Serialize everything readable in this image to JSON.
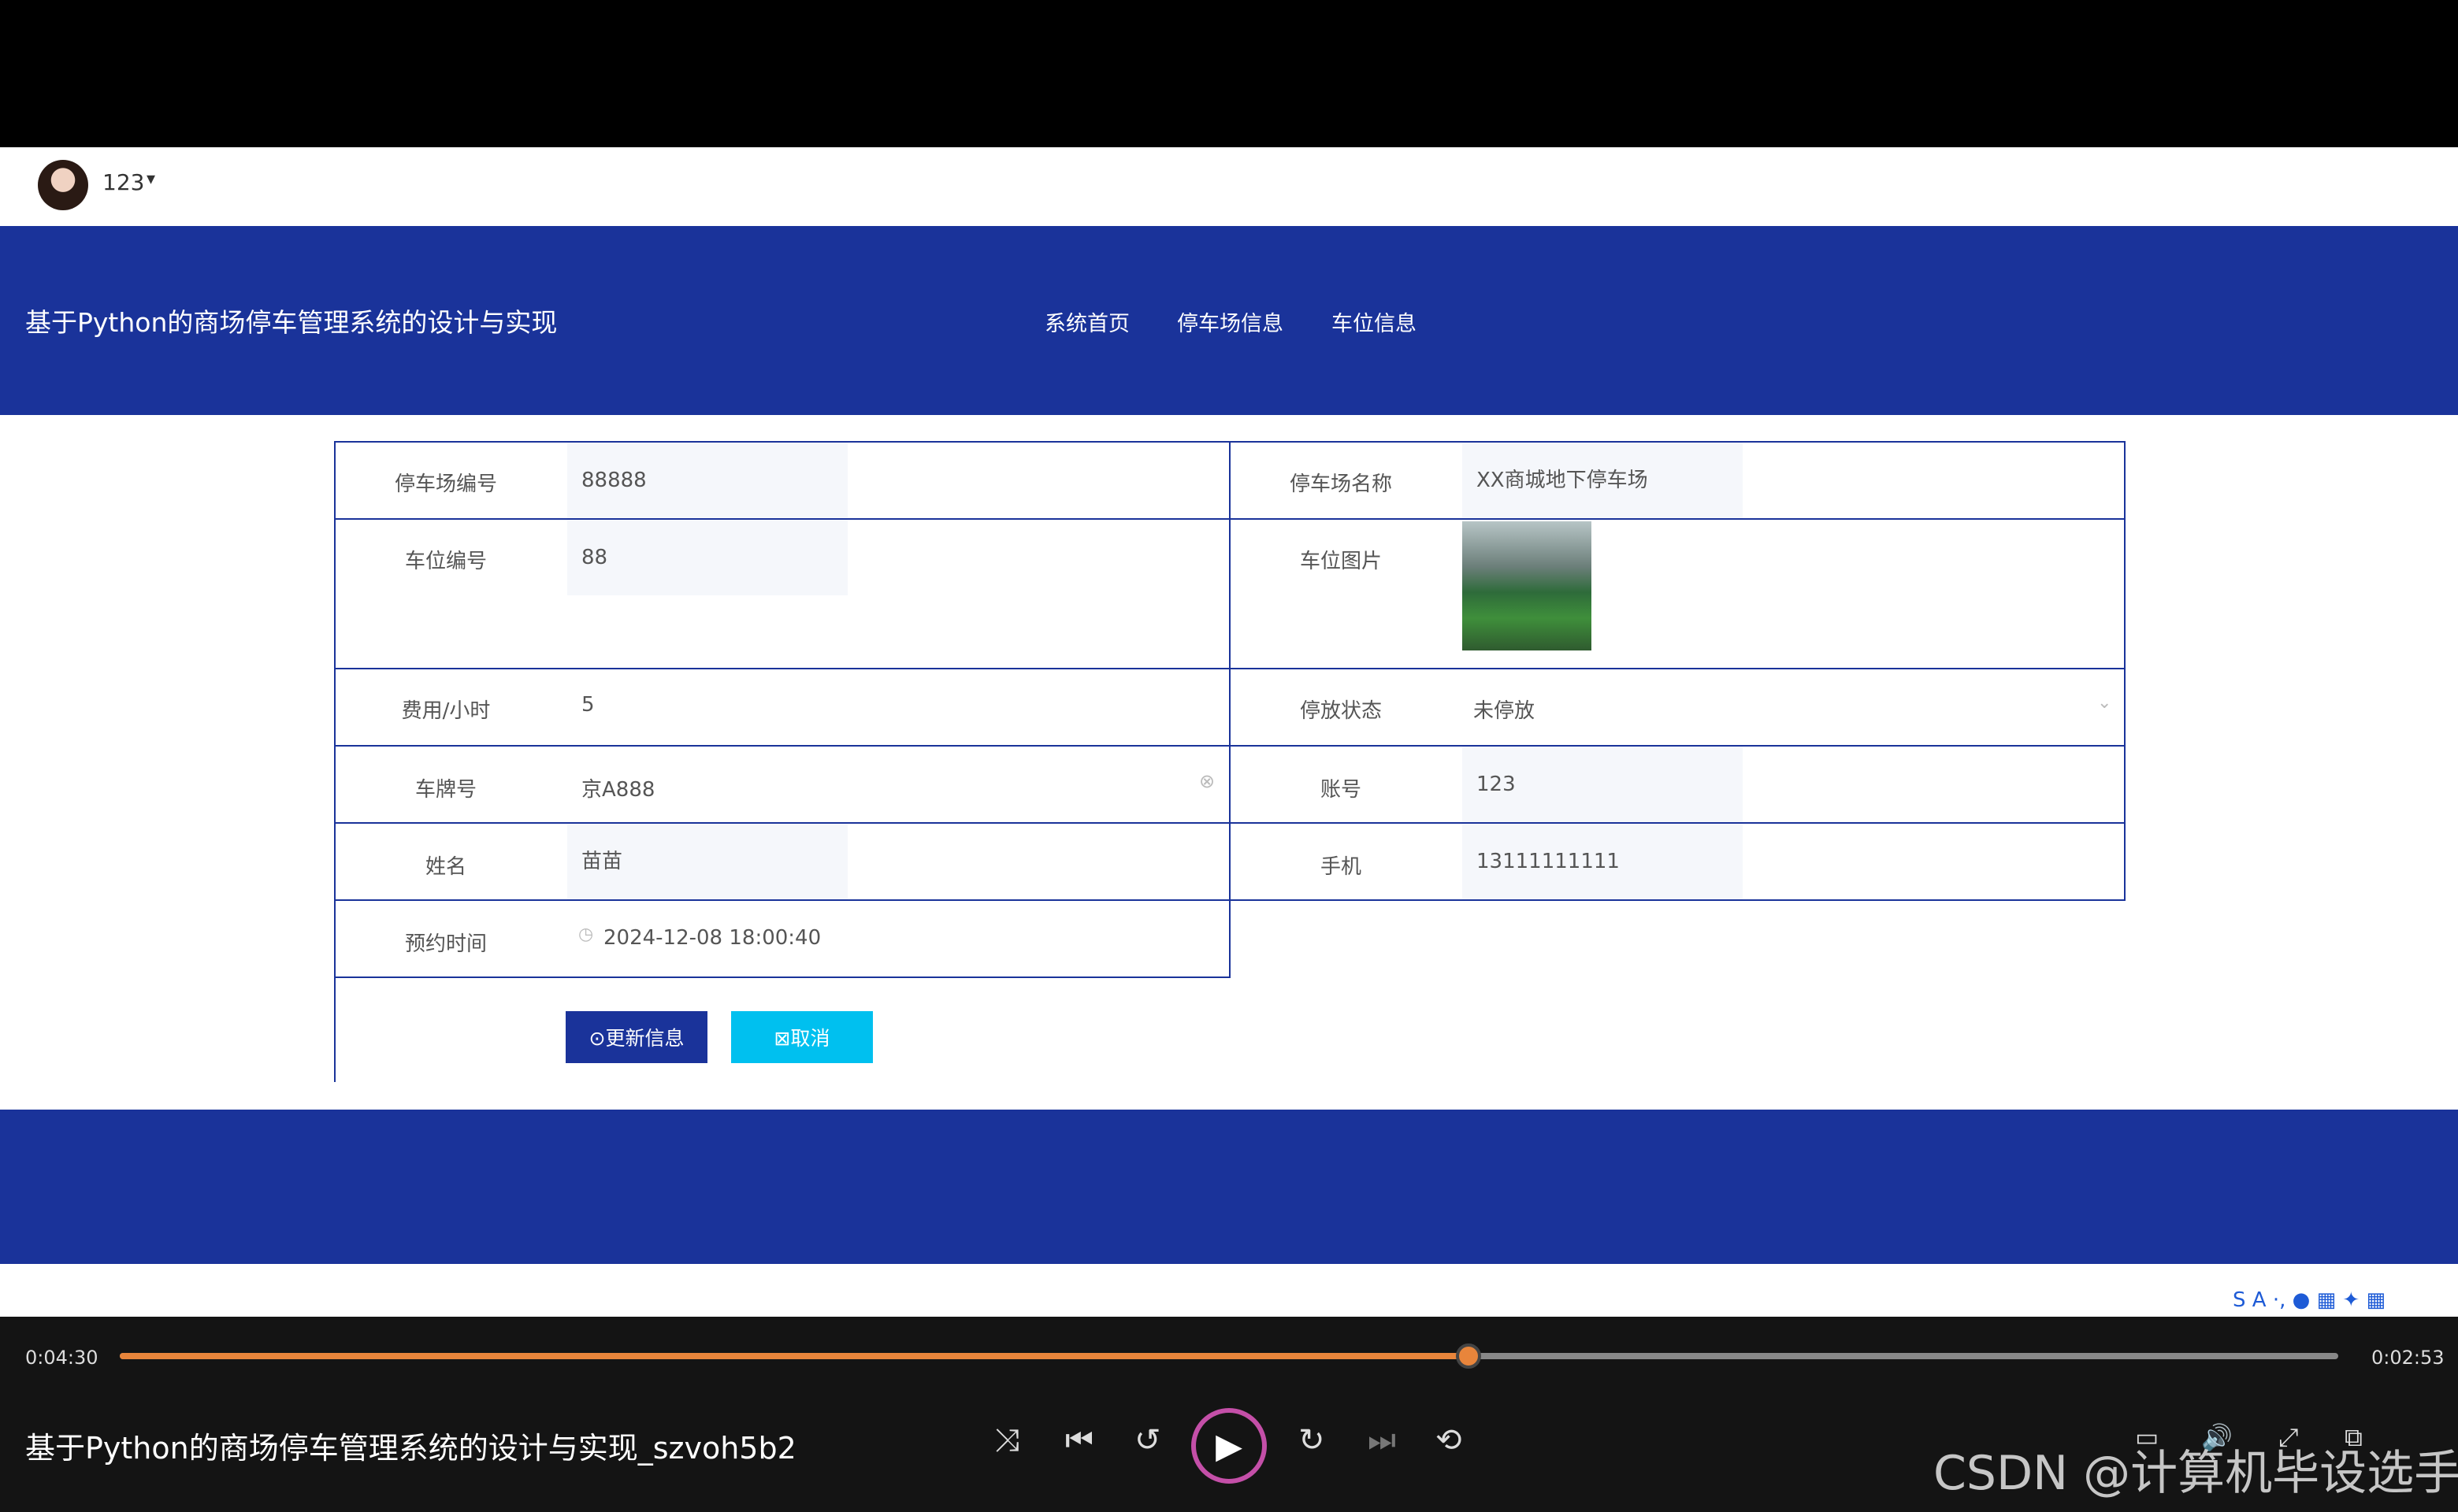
{
  "user": {
    "name": "123"
  },
  "site": {
    "title": "基于Python的商场停车管理系统的设计与实现",
    "nav": [
      "系统首页",
      "停车场信息",
      "车位信息"
    ]
  },
  "form": {
    "lot_no": {
      "label": "停车场编号",
      "value": "88888"
    },
    "lot_name": {
      "label": "停车场名称",
      "value": "XX商城地下停车场"
    },
    "space_no": {
      "label": "车位编号",
      "value": "88"
    },
    "space_image": {
      "label": "车位图片"
    },
    "fee": {
      "label": "费用/小时",
      "value": "5"
    },
    "status": {
      "label": "停放状态",
      "value": "未停放"
    },
    "plate": {
      "label": "车牌号",
      "value": "京A888"
    },
    "account": {
      "label": "账号",
      "value": "123"
    },
    "name": {
      "label": "姓名",
      "value": "苗苗"
    },
    "phone": {
      "label": "手机",
      "value": "13111111111"
    },
    "reserve_time": {
      "label": "预约时间",
      "value": "2024-12-08 18:00:40"
    },
    "update_button": "更新信息",
    "cancel_button": "取消"
  },
  "player": {
    "current": "0:04:30",
    "total": "0:02:53",
    "progress": 0.608,
    "title": "基于Python的商场停车管理系统的设计与实现_szvoh5b2"
  },
  "watermark": "CSDN @计算机毕设选手",
  "colors": {
    "primary": "#1a339a",
    "accent": "#00c0ef",
    "progress": "#e8853b"
  }
}
